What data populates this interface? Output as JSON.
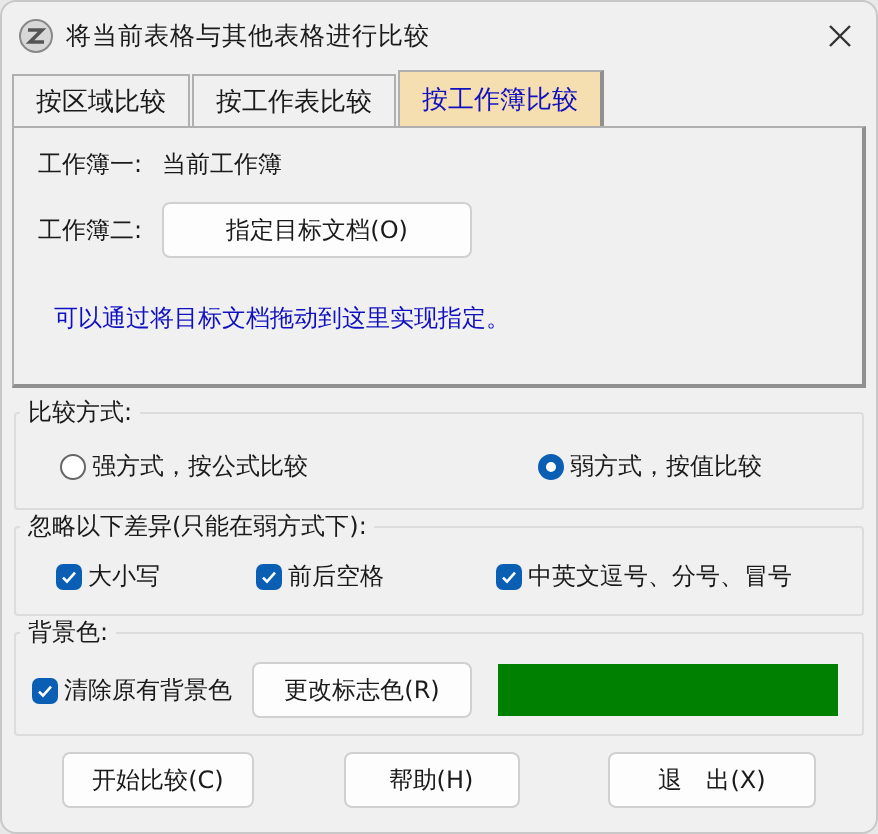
{
  "window": {
    "title": "将当前表格与其他表格进行比较"
  },
  "tabs": [
    {
      "label": "按区域比较",
      "selected": false
    },
    {
      "label": "按工作表比较",
      "selected": false
    },
    {
      "label": "按工作簿比较",
      "selected": true
    }
  ],
  "workbook_panel": {
    "workbook_1": {
      "label": "工作簿一:",
      "value": "当前工作簿"
    },
    "workbook_2": {
      "label": "工作簿二:",
      "button": "指定目标文档(O)"
    },
    "hint": "可以通过将目标文档拖动到这里实现指定。"
  },
  "compare_mode": {
    "label": "比较方式:",
    "options": [
      {
        "label": "强方式，按公式比较",
        "selected": false
      },
      {
        "label": "弱方式，按值比较",
        "selected": true
      }
    ]
  },
  "ignore_differences": {
    "label": "忽略以下差异(只能在弱方式下):",
    "options": [
      {
        "label": "大小写",
        "checked": true
      },
      {
        "label": "前后空格",
        "checked": true
      },
      {
        "label": "中英文逗号、分号、冒号",
        "checked": true
      }
    ]
  },
  "background": {
    "label": "背景色:",
    "clear_option": {
      "label": "清除原有背景色",
      "checked": true
    },
    "button": "更改标志色(R)",
    "color": "#008000"
  },
  "buttons": [
    "开始比较(C)",
    "帮助(H)",
    "退　出(X)"
  ]
}
